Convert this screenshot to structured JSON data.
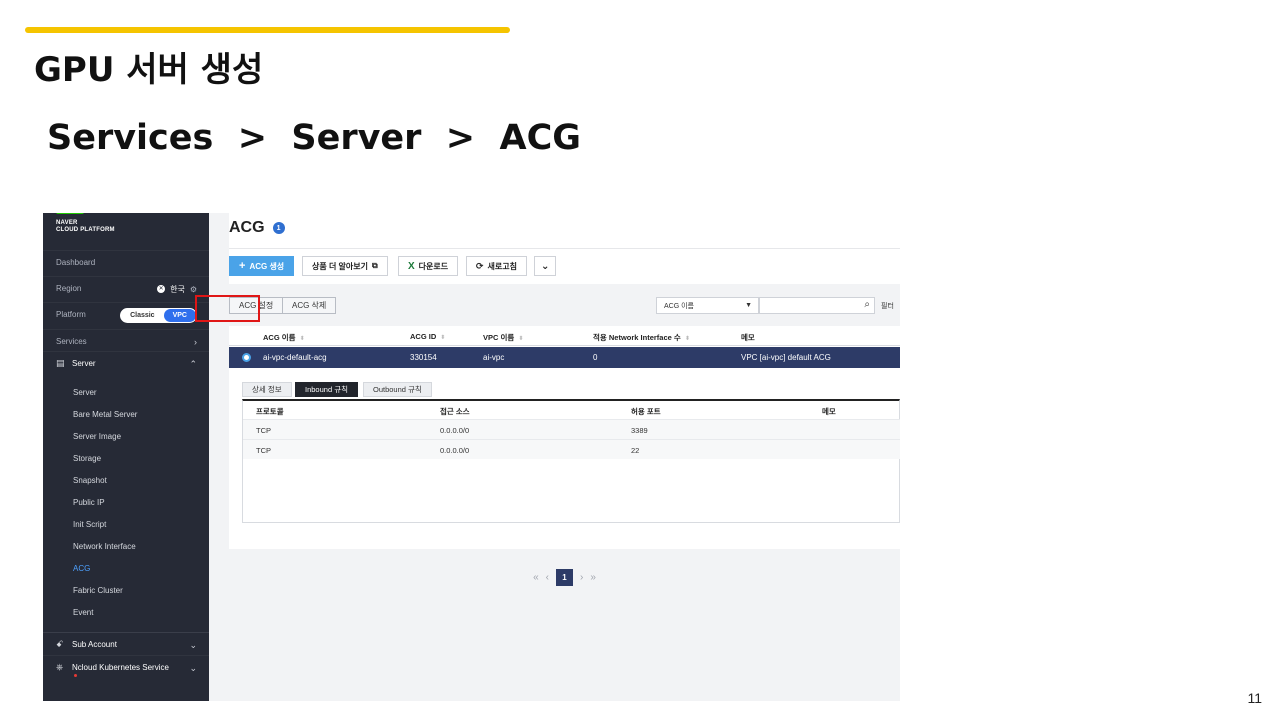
{
  "slide": {
    "title": "GPU 서버 생성",
    "breadcrumb": "Services  >  Server  >  ACG",
    "page_number": "11",
    "accent_color": "#f5c400"
  },
  "sidebar": {
    "logo_line1": "NAVER",
    "logo_line2": "CLOUD PLATFORM",
    "dashboard": "Dashboard",
    "region_label": "Region",
    "region_value": "한국",
    "platform_label": "Platform",
    "platform_options": [
      "Classic",
      "VPC"
    ],
    "platform_selected": "VPC",
    "services": "Services",
    "server_group": "Server",
    "server_items": [
      "Server",
      "Bare Metal Server",
      "Server Image",
      "Storage",
      "Snapshot",
      "Public IP",
      "Init Script",
      "Network Interface",
      "ACG",
      "Fabric Cluster",
      "Event"
    ],
    "active_item": "ACG",
    "sub_account": "Sub Account",
    "kubernetes": "Ncloud Kubernetes Service"
  },
  "main": {
    "title": "ACG",
    "count": "1",
    "toolbar": {
      "create": "ACG 생성",
      "learn_more": "상품 더 알아보기",
      "download": "다운로드",
      "refresh": "새로고침"
    },
    "actions": {
      "settings": "ACG 설정",
      "delete": "ACG 삭제"
    },
    "filter": {
      "select_value": "ACG 이름",
      "more": "필터"
    },
    "table": {
      "headers": [
        "ACG 이름",
        "ACG ID",
        "VPC 이름",
        "적용 Network Interface 수",
        "메모"
      ],
      "rows": [
        {
          "name": "ai-vpc-default-acg",
          "id": "330154",
          "vpc": "ai-vpc",
          "ni_count": "0",
          "memo": "VPC [ai-vpc] default ACG"
        }
      ]
    },
    "detail": {
      "tabs": [
        "상세 정보",
        "Inbound 규칙",
        "Outbound 규칙"
      ],
      "active_tab": "Inbound 규칙",
      "headers": [
        "프로토콜",
        "접근 소스",
        "허용 포트",
        "메모"
      ],
      "rows": [
        {
          "protocol": "TCP",
          "source": "0.0.0.0/0",
          "port": "3389",
          "memo": ""
        },
        {
          "protocol": "TCP",
          "source": "0.0.0.0/0",
          "port": "22",
          "memo": ""
        }
      ]
    },
    "pager": {
      "current": "1"
    }
  }
}
